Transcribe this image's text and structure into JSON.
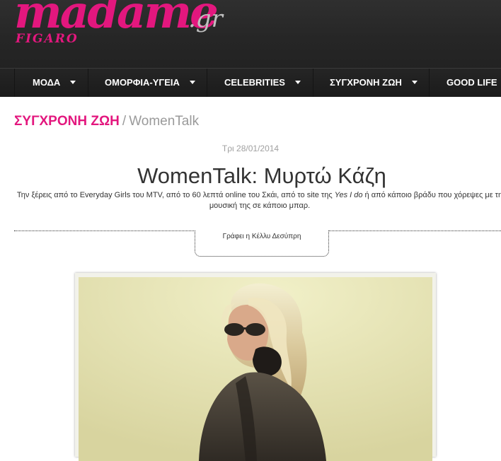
{
  "site": {
    "logo_word": "madame",
    "logo_suffix": ".gr",
    "logo_sub": "FIGARO",
    "brand_color": "#e3177e"
  },
  "nav": {
    "items": [
      {
        "label": "ΜΟΔΑ"
      },
      {
        "label": "ΟΜΟΡΦΙΑ-ΥΓΕΙΑ"
      },
      {
        "label": "CELEBRITIES"
      },
      {
        "label": "ΣΥΓΧΡΟΝΗ ΖΩΗ"
      },
      {
        "label": "GOOD LIFE"
      }
    ]
  },
  "breadcrumb": {
    "section": "ΣΥΓΧΡΟΝΗ ΖΩΗ",
    "separator": "/",
    "current": "WomenTalk"
  },
  "article": {
    "date": "Τρι 28/01/2014",
    "title": "WomenTalk: Μυρτώ Κάζη",
    "lead_part1": "Την ξέρεις από το Everyday Girls του MTV, από το 60 λεπτά online του Σκάι, από το site της ",
    "lead_italic": "Yes I do",
    "lead_part2": " ή από κάποιο βράδυ που χόρεψες με τη μουσική της σε κάποιο μπαρ.",
    "author": "Γράφει η Κέλλυ Δεσύπρη"
  }
}
